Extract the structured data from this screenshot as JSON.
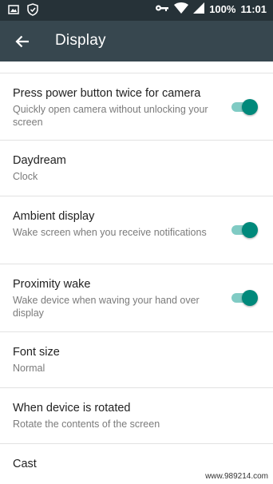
{
  "status_bar": {
    "battery": "100%",
    "time": "11:01"
  },
  "toolbar": {
    "title": "Display"
  },
  "settings": [
    {
      "title": "Press power button twice for camera",
      "subtitle": "Quickly open camera without unlocking your screen",
      "toggle": true,
      "enabled": true
    },
    {
      "title": "Daydream",
      "subtitle": "Clock",
      "toggle": false
    },
    {
      "title": "Ambient display",
      "subtitle": "Wake screen when you receive notifications",
      "toggle": true,
      "enabled": true
    },
    {
      "title": "Proximity wake",
      "subtitle": "Wake device when waving your hand over display",
      "toggle": true,
      "enabled": true
    },
    {
      "title": "Font size",
      "subtitle": "Normal",
      "toggle": false
    },
    {
      "title": "When device is rotated",
      "subtitle": "Rotate the contents of the screen",
      "toggle": false
    },
    {
      "title": "Cast",
      "subtitle": "",
      "toggle": false
    }
  ],
  "watermark": "www.989214.com",
  "colors": {
    "status_bar": "#263238",
    "toolbar": "#37474f",
    "accent": "#00897b"
  }
}
